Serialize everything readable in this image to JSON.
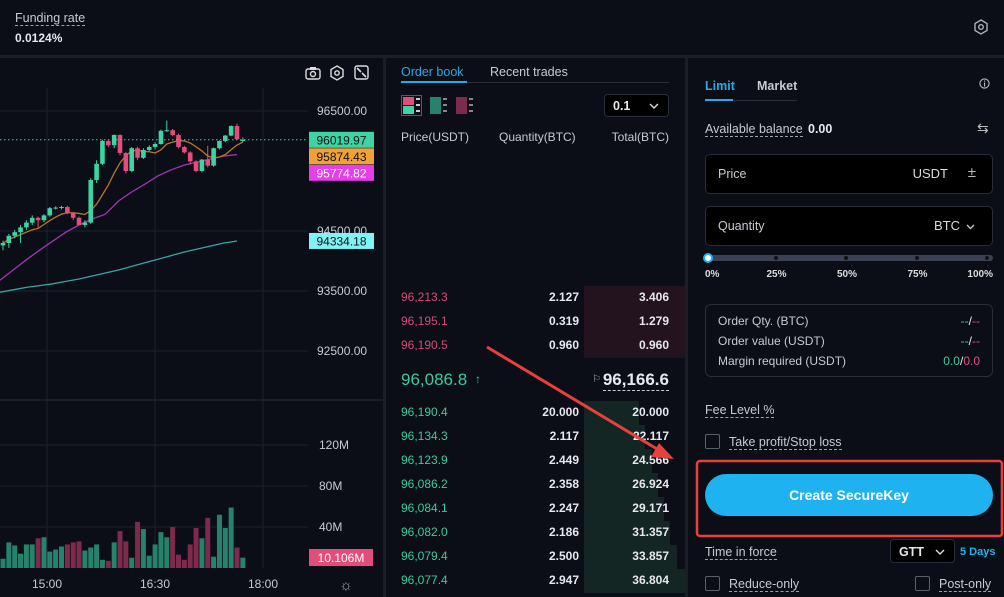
{
  "topbar": {
    "funding_label": "Funding rate",
    "funding_value": "0.0124%",
    "icon": "gear-icon"
  },
  "chart": {
    "toolbar_icons": [
      "camera-icon",
      "settings-icon",
      "fullscreen-icon"
    ],
    "price_ticks": [
      "96500.00",
      "94500.00",
      "93500.00",
      "92500.00"
    ],
    "price_tick_values": [
      96500,
      94500,
      93500,
      92500
    ],
    "volume_ticks": [
      "120M",
      "80M",
      "40M"
    ],
    "volume_tick_values": [
      120,
      80,
      40
    ],
    "time_ticks": [
      "15:00",
      "16:30",
      "18:00"
    ],
    "badges": [
      {
        "label": "96019.97",
        "value": 96019.97,
        "color": "#3ed3a3"
      },
      {
        "label": "95874.43",
        "value": 95874.43,
        "color": "#f0a23a"
      },
      {
        "label": "95774.82",
        "value": 95774.82,
        "color": "#e63ee8"
      },
      {
        "label": "94334.18",
        "value": 94334.18,
        "color": "#7ff3f5"
      }
    ],
    "volume_badge": "10.106M",
    "colors": {
      "up": "#3ed3a3",
      "down": "#e44d7b",
      "vol_up": "#26826a",
      "vol_down": "#7d2a4b",
      "ma_short": "#b8752e",
      "ma_mid": "#a532b8",
      "ma_long": "#3aa3a3"
    },
    "candles_ohlc": [
      [
        94260,
        94340,
        94180,
        94300
      ],
      [
        94300,
        94450,
        94220,
        94420
      ],
      [
        94420,
        94520,
        94380,
        94480
      ],
      [
        94480,
        94600,
        94300,
        94560
      ],
      [
        94560,
        94680,
        94520,
        94640
      ],
      [
        94640,
        94760,
        94600,
        94720
      ],
      [
        94720,
        94740,
        94560,
        94680
      ],
      [
        94680,
        94780,
        94650,
        94760
      ],
      [
        94760,
        94900,
        94740,
        94880
      ],
      [
        94880,
        94910,
        94860,
        94890
      ],
      [
        94890,
        94920,
        94860,
        94900
      ],
      [
        94900,
        94920,
        94780,
        94800
      ],
      [
        94800,
        94820,
        94680,
        94720
      ],
      [
        94720,
        94740,
        94600,
        94600
      ],
      [
        94600,
        94680,
        94560,
        94640
      ],
      [
        94640,
        95380,
        94620,
        95350
      ],
      [
        95350,
        95680,
        95300,
        95620
      ],
      [
        95620,
        96020,
        95600,
        96000
      ],
      [
        96000,
        96020,
        95900,
        95930
      ],
      [
        95930,
        96110,
        95880,
        96100
      ],
      [
        96100,
        96110,
        95760,
        95800
      ],
      [
        95800,
        95820,
        95460,
        95500
      ],
      [
        95500,
        95900,
        95480,
        95880
      ],
      [
        95880,
        95900,
        95680,
        95720
      ],
      [
        95720,
        95880,
        95700,
        95850
      ],
      [
        95850,
        95930,
        95830,
        95900
      ],
      [
        95900,
        95980,
        95860,
        95950
      ],
      [
        95950,
        96190,
        95940,
        96170
      ],
      [
        96170,
        96340,
        96150,
        96180
      ],
      [
        96180,
        96200,
        96080,
        96100
      ],
      [
        96100,
        96120,
        95880,
        95900
      ],
      [
        95900,
        95920,
        95790,
        95810
      ],
      [
        95810,
        95830,
        95620,
        95660
      ],
      [
        95660,
        95680,
        95480,
        95500
      ],
      [
        95500,
        95700,
        95480,
        95690
      ],
      [
        95690,
        95920,
        95560,
        95590
      ],
      [
        95590,
        95890,
        95570,
        95880
      ],
      [
        95880,
        96010,
        95860,
        96000
      ],
      [
        96000,
        96100,
        95980,
        96090
      ],
      [
        96090,
        96260,
        96080,
        96250
      ],
      [
        96250,
        96290,
        96020,
        96030
      ],
      [
        96000,
        96060,
        95980,
        96020
      ]
    ],
    "volumes_m": [
      9,
      25,
      22,
      14,
      23,
      23,
      29,
      30,
      16,
      18,
      21,
      23,
      25,
      26,
      17,
      20,
      23,
      8,
      7,
      25,
      36,
      26,
      10,
      45,
      38,
      12,
      23,
      35,
      30,
      40,
      13,
      8,
      23,
      39,
      29,
      49,
      11,
      52,
      39,
      59,
      20,
      10.1
    ],
    "ma_mid": [
      93680,
      93850,
      94020,
      94180,
      94330,
      94480,
      94600,
      94700,
      94780,
      95000,
      95150,
      95280,
      95420,
      95520,
      95600,
      95650,
      95700,
      95750,
      95774
    ],
    "ma_long": [
      93480,
      93520,
      93560,
      93590,
      93620,
      93660,
      93700,
      93750,
      93800,
      93850,
      93910,
      93970,
      94030,
      94090,
      94150,
      94200,
      94250,
      94300,
      94334
    ]
  },
  "orderbook": {
    "tabs": [
      {
        "label": "Order book",
        "active": true
      },
      {
        "label": "Recent trades",
        "active": false
      }
    ],
    "view_icons": [
      "both-sides-icon",
      "bids-only-icon",
      "asks-only-icon"
    ],
    "precision": "0.1",
    "columns": [
      "Price(USDT)",
      "Quantity(BTC)",
      "Total(BTC)"
    ],
    "asks": [
      {
        "price": "96,213.3",
        "qty": "2.127",
        "total": "3.406",
        "depth": 0.46
      },
      {
        "price": "96,195.1",
        "qty": "0.319",
        "total": "1.279",
        "depth": 0.46
      },
      {
        "price": "96,190.5",
        "qty": "0.960",
        "total": "0.960",
        "depth": 0.46
      }
    ],
    "last_price": "96,086.8",
    "mark_price": "96,166.6",
    "bids": [
      {
        "price": "96,190.4",
        "qty": "20.000",
        "total": "20.000",
        "depth": 0.54
      },
      {
        "price": "96,134.3",
        "qty": "2.117",
        "total": "22.117",
        "depth": 0.6
      },
      {
        "price": "96,123.9",
        "qty": "2.449",
        "total": "24.566",
        "depth": 0.67
      },
      {
        "price": "96,086.2",
        "qty": "2.358",
        "total": "26.924",
        "depth": 0.73
      },
      {
        "price": "96,084.1",
        "qty": "2.247",
        "total": "29.171",
        "depth": 0.79
      },
      {
        "price": "96,082.0",
        "qty": "2.186",
        "total": "31.357",
        "depth": 0.85
      },
      {
        "price": "96,079.4",
        "qty": "2.500",
        "total": "33.857",
        "depth": 0.92
      },
      {
        "price": "96,077.4",
        "qty": "2.947",
        "total": "36.804",
        "depth": 1.0
      }
    ],
    "colors": {
      "ask": "#d64b75",
      "bid": "#3ec99b"
    }
  },
  "trade": {
    "tabs": [
      {
        "label": "Limit",
        "active": true
      },
      {
        "label": "Market",
        "active": false
      }
    ],
    "balance_label": "Available balance",
    "balance_value": "0.00",
    "price_label": "Price",
    "price_unit": "USDT",
    "qty_label": "Quantity",
    "qty_unit": "BTC",
    "slider_value_pct": 0,
    "slider_marks": [
      "0%",
      "25%",
      "50%",
      "75%",
      "100%"
    ],
    "summary": [
      {
        "label": "Order Qty. (BTC)",
        "buy": "--",
        "sell": "--"
      },
      {
        "label": "Order value (USDT)",
        "buy": "--",
        "sell": "--"
      },
      {
        "label": "Margin required (USDT)",
        "buy": "0.0",
        "sell": "0.0"
      }
    ],
    "fee_label": "Fee Level %",
    "tpsl_label": "Take profit/Stop loss",
    "submit_label": "Create SecureKey",
    "tif_label": "Time in force",
    "tif_value": "GTT",
    "tif_days": "5 Days",
    "reduce_label": "Reduce-only",
    "post_label": "Post-only",
    "accent": "#1eb2f0"
  }
}
